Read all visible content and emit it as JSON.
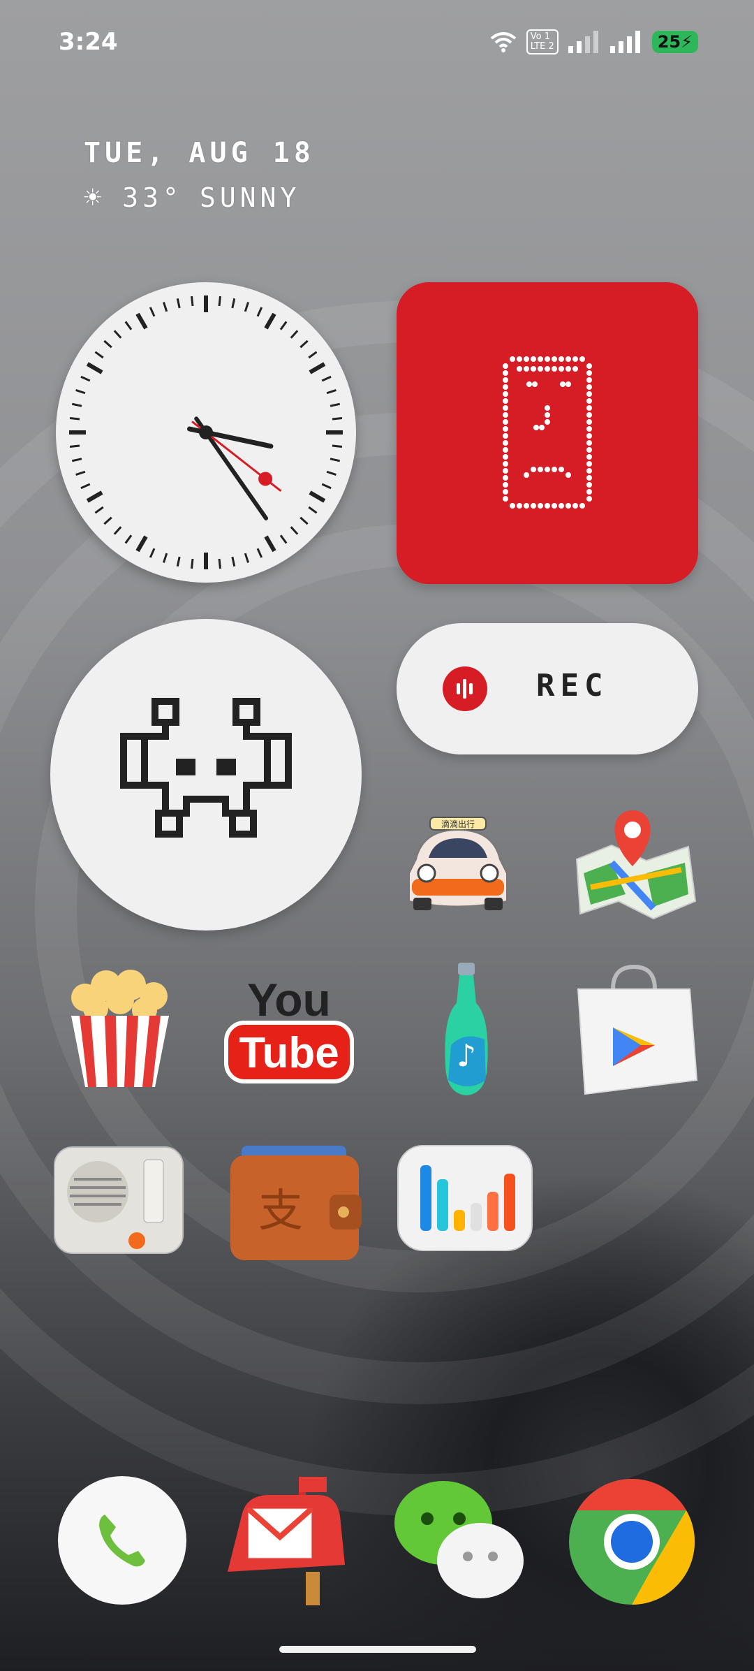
{
  "status_bar": {
    "time": "3:24",
    "volte_label_top": "Vo",
    "volte_label_bottom": "LTE",
    "sim1": "1",
    "sim2": "2",
    "battery": "25"
  },
  "date_weather": {
    "date": "TUE, AUG 18",
    "temperature": "33°",
    "condition": "SUNNY"
  },
  "record_widget": {
    "label": "REC"
  },
  "taxi_sign": "滴滴出行",
  "app_icons": [
    "taxi-app-icon",
    "maps-icon",
    "popcorn-app-icon",
    "youtube-icon",
    "music-bottle-icon",
    "play-store-icon",
    "radio-icon",
    "wallet-icon",
    "stats-icon"
  ],
  "youtube_text": {
    "top": "You",
    "bottom": "Tube"
  },
  "wallet_symbol": "支",
  "dock": [
    "phone-icon",
    "gmail-mailbox-icon",
    "wechat-icon",
    "chrome-icon"
  ],
  "colors": {
    "accent_red": "#d61d26",
    "widget_bg": "#f0f0f0",
    "battery_green": "#2db75a"
  }
}
